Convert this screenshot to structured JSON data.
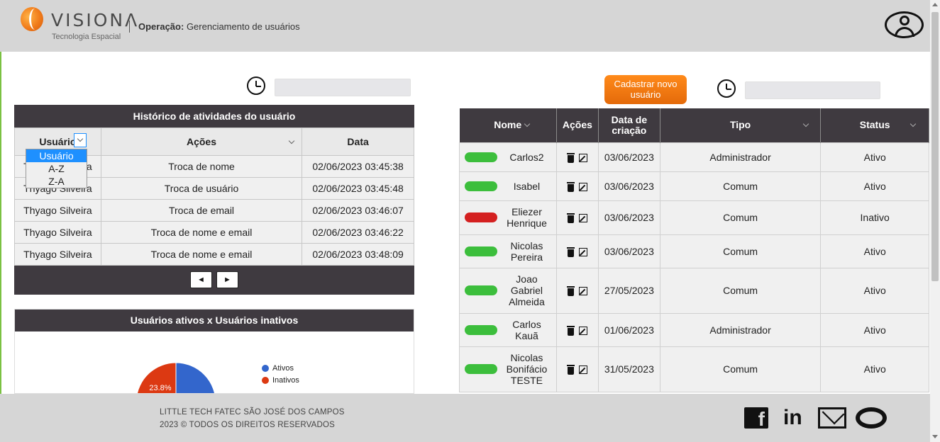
{
  "header": {
    "logo_text": "VISIONΛ",
    "logo_sub": "Tecnologia Espacial",
    "operation_label": "Operação:",
    "operation_value": "Gerenciamento de usuários"
  },
  "history": {
    "title": "Histórico de atividades do usuário",
    "columns": [
      "Usuário",
      "Ações",
      "Data"
    ],
    "rows": [
      [
        "Thyago Silveira",
        "Troca de nome",
        "02/06/2023 03:45:38"
      ],
      [
        "Thyago Silveira",
        "Troca de usuário",
        "02/06/2023 03:45:48"
      ],
      [
        "Thyago Silveira",
        "Troca de email",
        "02/06/2023 03:46:07"
      ],
      [
        "Thyago Silveira",
        "Troca de nome e email",
        "02/06/2023 03:46:22"
      ],
      [
        "Thyago Silveira",
        "Troca de nome e email",
        "02/06/2023 03:48:09"
      ]
    ],
    "dropdown_options": [
      "Usuário",
      "A-Z",
      "Z-A"
    ],
    "prev_label": "◄",
    "next_label": "►"
  },
  "chart": {
    "title": "Usuários ativos x Usuários inativos",
    "legend": [
      {
        "label": "Ativos",
        "color": "#3366cc"
      },
      {
        "label": "Inativos",
        "color": "#dc3912"
      }
    ],
    "slice_label": "23.8%"
  },
  "chart_data": {
    "type": "pie",
    "title": "Usuários ativos x Usuários inativos",
    "categories": [
      "Ativos",
      "Inativos"
    ],
    "values": [
      76.2,
      23.8
    ],
    "legend": "right"
  },
  "register_button": "Cadastrar novo usuário",
  "users": {
    "columns": [
      "Nome",
      "Ações",
      "Data de criação",
      "Tipo",
      "Status"
    ],
    "rows": [
      {
        "name": "Carlos2",
        "date": "03/06/2023",
        "type": "Administrador",
        "status": "Ativo",
        "color": "#3cbe3c"
      },
      {
        "name": "Isabel",
        "date": "03/06/2023",
        "type": "Comum",
        "status": "Ativo",
        "color": "#3cbe3c"
      },
      {
        "name": "Eliezer Henrique",
        "date": "03/06/2023",
        "type": "Comum",
        "status": "Inativo",
        "color": "#d42020"
      },
      {
        "name": "Nicolas Pereira",
        "date": "03/06/2023",
        "type": "Comum",
        "status": "Ativo",
        "color": "#3cbe3c"
      },
      {
        "name": "Joao Gabriel Almeida",
        "date": "27/05/2023",
        "type": "Comum",
        "status": "Ativo",
        "color": "#3cbe3c"
      },
      {
        "name": "Carlos Kauã",
        "date": "01/06/2023",
        "type": "Administrador",
        "status": "Ativo",
        "color": "#3cbe3c"
      },
      {
        "name": "Nicolas Bonifácio TESTE",
        "date": "31/05/2023",
        "type": "Comum",
        "status": "Ativo",
        "color": "#3cbe3c"
      }
    ]
  },
  "footer": {
    "line1": "LITTLE TECH FATEC SÃO JOSÉ DOS CAMPOS",
    "line2": "2023 © TODOS OS DIREITOS RESERVADOS"
  }
}
